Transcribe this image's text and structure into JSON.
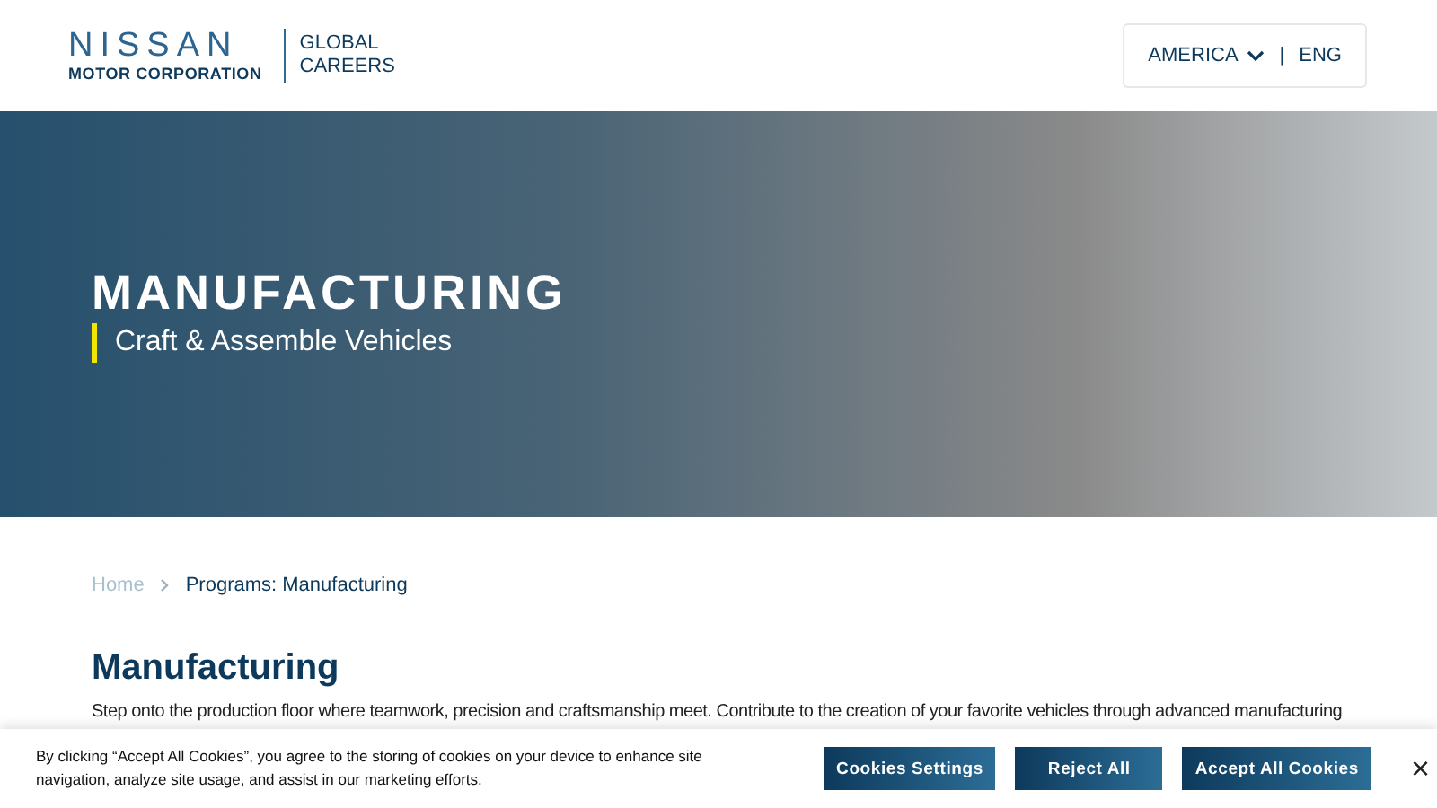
{
  "header": {
    "logo": {
      "brand": "NISSAN",
      "subtitle": "MOTOR CORPORATION"
    },
    "site_name": [
      "GLOBAL",
      "CAREERS"
    ],
    "region": "AMERICA",
    "separator": "|",
    "language": "ENG"
  },
  "hero": {
    "title": "MANUFACTURING",
    "subtitle": "Craft & Assemble Vehicles"
  },
  "breadcrumb": [
    {
      "label": "Home",
      "current": false
    },
    {
      "label": "Programs: Manufacturing",
      "current": true
    }
  ],
  "section": {
    "heading": "Manufacturing",
    "text": "Step onto the production floor where teamwork, precision and craftsmanship meet. Contribute to the creation of your favorite vehicles through advanced manufacturing"
  },
  "cookie_banner": {
    "text": "By clicking “Accept All Cookies”, you agree to the storing of cookies on your device to enhance site navigation, analyze site usage, and assist in our marketing efforts.",
    "buttons": [
      "Cookies Settings",
      "Reject All",
      "Accept All Cookies"
    ],
    "close": "×"
  }
}
